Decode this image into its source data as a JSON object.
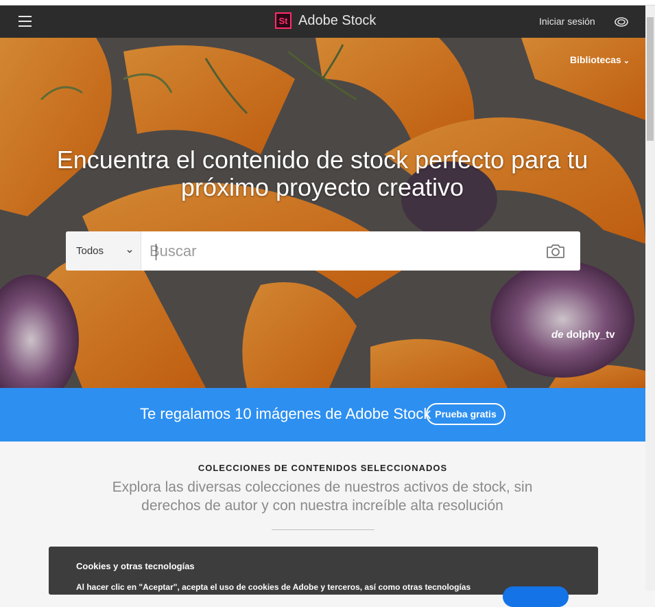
{
  "header": {
    "menu_icon": "hamburger-menu-icon",
    "logo_badge": "St",
    "logo_text": "Adobe Stock",
    "signin_label": "Iniciar sesión",
    "cc_icon": "creative-cloud-icon"
  },
  "hero": {
    "libraries_label": "Bibliotecas",
    "libraries_chevron": "⌄",
    "title": "Encuentra el contenido de stock perfecto para tu próximo proyecto creativo",
    "search": {
      "category_value": "Todos",
      "placeholder": "Buscar",
      "camera_icon": "camera-icon"
    },
    "credit_prefix": "de",
    "credit_author": "dolphy_tv"
  },
  "promo": {
    "text": "Te regalamos 10 imágenes de Adobe Stock",
    "button_label": "Prueba gratis"
  },
  "collections": {
    "heading": "COLECCIONES DE CONTENIDOS SELECCIONADOS",
    "description": "Explora las diversas colecciones de nuestros activos de stock, sin derechos de autor y con nuestra increíble alta resolución"
  },
  "cookies": {
    "title": "Cookies y otras tecnologías",
    "text": "Al hacer clic en \"Aceptar\", acepta el uso de cookies de Adobe y terceros, así como otras tecnologías"
  },
  "colors": {
    "header_bg": "#2c2c2c",
    "promo_bg": "#2d8ff0",
    "brand_pink": "#ff2d6a",
    "accept_blue": "#1473e6"
  }
}
